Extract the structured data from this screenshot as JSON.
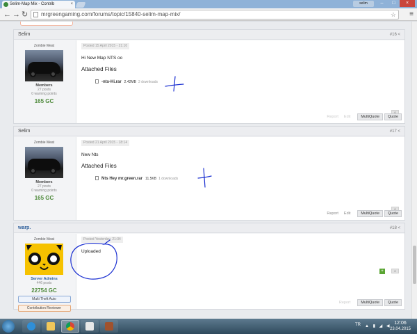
{
  "browser": {
    "tab_title": "Selim-Map Mix - Contrib",
    "tab_close": "×",
    "window_user": "selim",
    "url": "mrgreengaming.com/forums/topic/15840-selim-map-mix/",
    "back_icon": "←",
    "forward_icon": "→",
    "reload_icon": "↻",
    "star_icon": "☆",
    "menu_icon": "≡",
    "min_icon": "–",
    "max_icon": "□",
    "close_icon": "×"
  },
  "posts": [
    {
      "username": "Selim",
      "post_number": "#16",
      "rank": "Zombie Meat",
      "group": "Members",
      "posts_count": "27 posts",
      "warning": "0 warning points",
      "gc": "165 GC",
      "date": "Posted 15 April 2015 - 21:10",
      "message": "Hi New Map NTS oo",
      "attached_title": "Attached Files",
      "file_name": "-nts-Hi.rar",
      "file_size": "2.42MB",
      "file_downloads": "3 downloads",
      "counter": "0",
      "report": "Report",
      "edit": "Edit",
      "multiquote": "MultiQuote",
      "quote": "Quote"
    },
    {
      "username": "Selim",
      "post_number": "#17",
      "rank": "Zombie Meat",
      "group": "Members",
      "posts_count": "27 posts",
      "warning": "0 warning points",
      "gc": "165 GC",
      "date": "Posted 21 April 2015 - 18:14",
      "message": "New Nts",
      "attached_title": "Attached Files",
      "file_name": "Nts Hey mr.green.rar",
      "file_size": "11.5KB",
      "file_downloads": "1 downloads",
      "counter": "0",
      "report": "Report",
      "edit": "Edit",
      "multiquote": "MultiQuote",
      "quote": "Quote"
    },
    {
      "username": "warp.",
      "post_number": "#18",
      "rank": "Zombie Meat",
      "group": "Server Admins",
      "posts_count": "446 posts",
      "gc": "22754 GC",
      "badge1": "Multi Theft Auto",
      "badge2": "Contribution Reviewer",
      "date": "Posted Yesterday, 21:34",
      "message": "Uploaded",
      "plus": "+",
      "counter": "0",
      "report": "Report",
      "multiquote": "MultiQuote",
      "quote": "Quote"
    }
  ],
  "taskbar": {
    "lang": "TR",
    "tray": "▲ ▮ ◢ ◀",
    "time": "12:06",
    "date": "23.04.2015"
  },
  "colors": {
    "accent_green": "#4f8a3c",
    "accent_blue": "#2d5e9a",
    "annotation_ink": "#1a2fd1"
  }
}
